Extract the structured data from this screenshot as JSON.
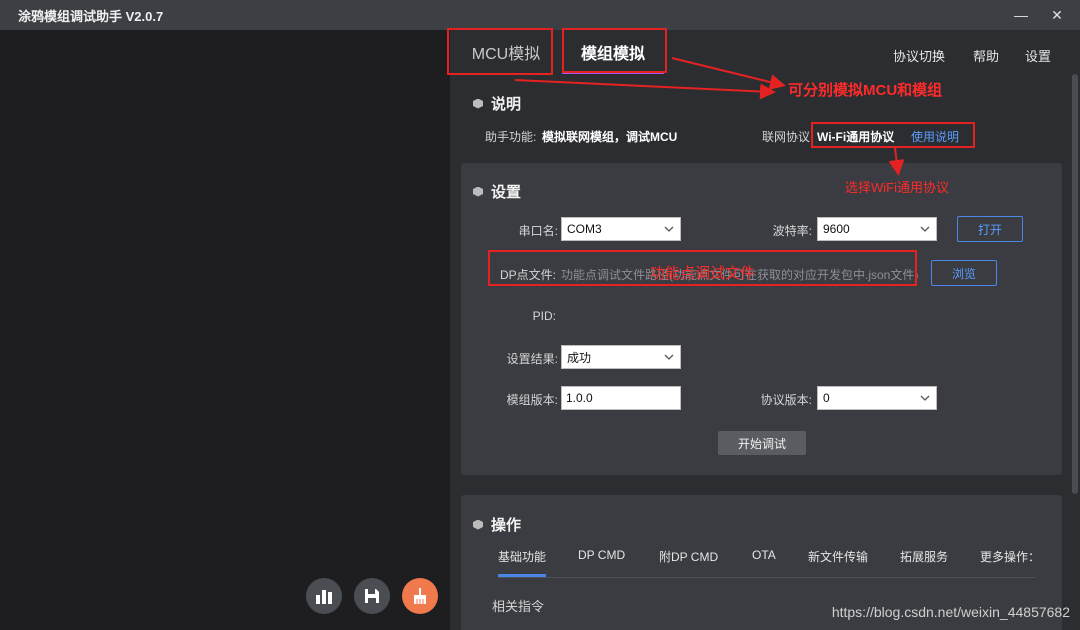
{
  "window": {
    "title": "涂鸦模组调试助手 V2.0.7",
    "minimize_glyph": "—",
    "close_glyph": "✕"
  },
  "tabs": {
    "mcu": "MCU模拟",
    "module": "模组模拟"
  },
  "top_menu": {
    "protocol_switch": "协议切换",
    "help": "帮助",
    "settings": "设置"
  },
  "description": {
    "title": "说明",
    "function_label": "助手功能:",
    "function_value": "模拟联网模组，调试MCU",
    "protocol_label": "联网协议",
    "protocol_value": "Wi-Fi通用协议",
    "usage_link": "使用说明"
  },
  "settings": {
    "title": "设置",
    "port_label": "串口名:",
    "port_value": "COM3",
    "baud_label": "波特率:",
    "baud_value": "9600",
    "open_button": "打开",
    "dp_file_label": "DP点文件:",
    "dp_file_placeholder": "功能点调试文件路径(功能点文件可在获取的对应开发包中.json文件)",
    "browse_button": "浏览",
    "pid_label": "PID:",
    "pid_value": "",
    "result_label": "设置结果:",
    "result_value": "成功",
    "module_version_label": "模组版本:",
    "module_version_value": "1.0.0",
    "protocol_version_label": "协议版本:",
    "protocol_version_value": "0",
    "start_button": "开始调试"
  },
  "operations": {
    "title": "操作",
    "tabs": [
      "基础功能",
      "DP CMD",
      "附DP CMD",
      "OTA",
      "新文件传输",
      "拓展服务",
      "更多操作："
    ],
    "related_commands": "相关指令"
  },
  "annotations": {
    "mcu_module_note": "可分别模拟MCU和模组",
    "wifi_protocol_note": "选择WiFi通用协议",
    "dp_file_note": "功能点调试文件",
    "color": "#e52222"
  },
  "watermark": "https://blog.csdn.net/weixin_44857682",
  "icons": {
    "chart": "bar-chart-icon",
    "save": "save-icon",
    "clean": "broom-icon"
  },
  "colors": {
    "accent": "#a855f7",
    "link": "#5a9cff",
    "active_round_button": "#f07a4e"
  }
}
